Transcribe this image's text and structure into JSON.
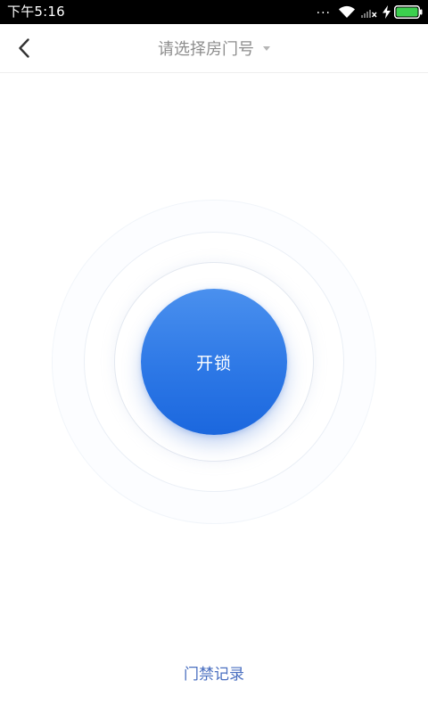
{
  "status_bar": {
    "time": "下午5:16",
    "icons": [
      "more-dots-icon",
      "wifi-icon",
      "signal-icon",
      "charging-icon",
      "battery-icon"
    ],
    "dots": "...",
    "battery_color": "#3ccf4e"
  },
  "header": {
    "back_icon": "chevron-left-icon",
    "title": "请选择房门号",
    "dropdown_icon": "caret-down-icon"
  },
  "main": {
    "unlock_label": "开锁",
    "accent_color": "#2d78e6"
  },
  "footer": {
    "records_link": "门禁记录",
    "link_color": "#4a6fc0"
  }
}
